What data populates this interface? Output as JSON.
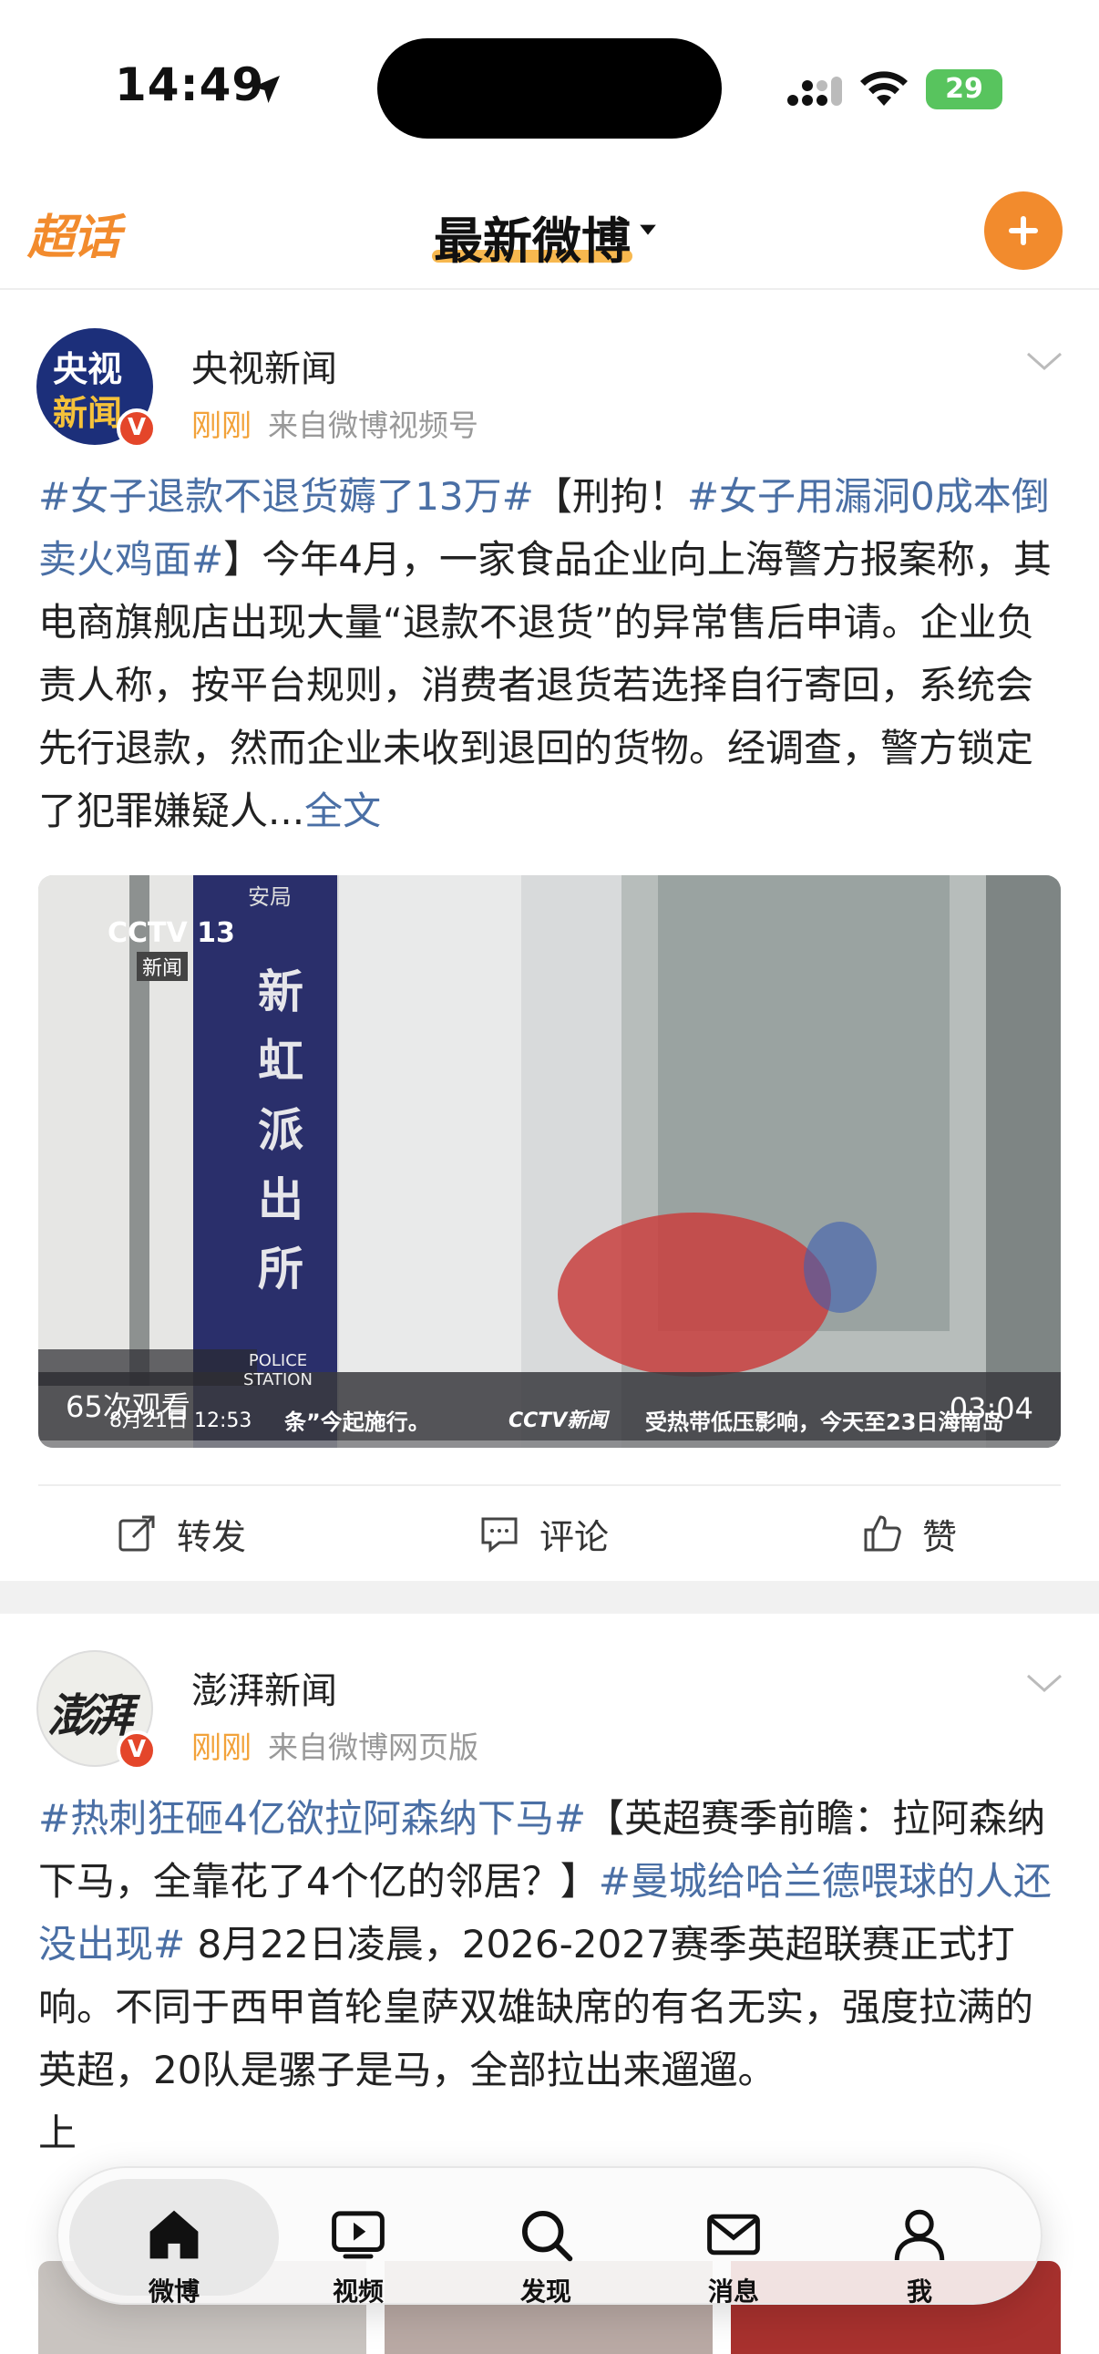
{
  "status_bar": {
    "time": "14:49",
    "battery": "29",
    "icons": [
      "location-arrow-icon",
      "cellular-signal-icon",
      "wifi-icon",
      "battery-charging-icon"
    ]
  },
  "header": {
    "left_label": "超话",
    "title": "最新微博",
    "accent_color": "#f28b2d",
    "icons": [
      "dropdown-caret-icon",
      "plus-icon"
    ]
  },
  "posts": [
    {
      "author": "央视新闻",
      "avatar_text": [
        "央视",
        "新闻"
      ],
      "time": "刚刚",
      "source": "来自微博视频号",
      "text": {
        "tag1": "#女子退款不退货薅了13万#",
        "seg1": "【刑拘！",
        "tag2": "#女子用漏洞0成本倒卖火鸡面#",
        "seg2": "】今年4月，一家食品企业向上海警方报案称，其电商旗舰店出现大量“退款不退货”的异常售后申请。企业负责人称，按平台规则，消费者退货若选择自行寄回，系统会先行退款，然而企业未收到退回的货物。经调查，警方锁定了犯罪嫌疑人...",
        "more": "全文"
      },
      "video": {
        "channel_logo": "CCTV 13",
        "channel_sub": "新闻",
        "sign_top": "安局",
        "sign_chars": [
          "新",
          "虹",
          "派",
          "出",
          "所"
        ],
        "sign_bottom": "POLICE STATION",
        "ticker_date": "8月21日 12:53",
        "ticker_text": "条”今起施行。",
        "ticker_logo": "CCTV新闻",
        "ticker_text2": "受热带低压影响，今天至23日海南岛",
        "views": "65次观看",
        "duration": "03:04"
      },
      "actions": {
        "repost": "转发",
        "comment": "评论",
        "like": "赞"
      }
    },
    {
      "author": "澎湃新闻",
      "avatar_text": [
        "澎湃"
      ],
      "time": "刚刚",
      "source": "来自微博网页版",
      "text": {
        "tag1": "#热刺狂砸4亿欲拉阿森纳下马#",
        "seg1": "【英超赛季前瞻：拉阿森纳下马，全靠花了4个亿的邻居？】",
        "tag2": "#曼城给哈兰德喂球的人还没出现#",
        "seg2": " 8月22日凌晨，2026-2027赛季英超联赛正式打响。不同于西甲首轮皇萨双雄缺席的有名无实，强度拉满的英超，20队是骡子是马，全部拉出来遛遛。",
        "seg3": "上"
      }
    }
  ],
  "tab_bar": {
    "tabs": [
      {
        "label": "微博",
        "icon": "home-icon",
        "active": true
      },
      {
        "label": "视频",
        "icon": "video-play-icon",
        "active": false
      },
      {
        "label": "发现",
        "icon": "search-icon",
        "active": false
      },
      {
        "label": "消息",
        "icon": "mail-icon",
        "active": false
      },
      {
        "label": "我",
        "icon": "profile-icon",
        "active": false
      }
    ]
  }
}
